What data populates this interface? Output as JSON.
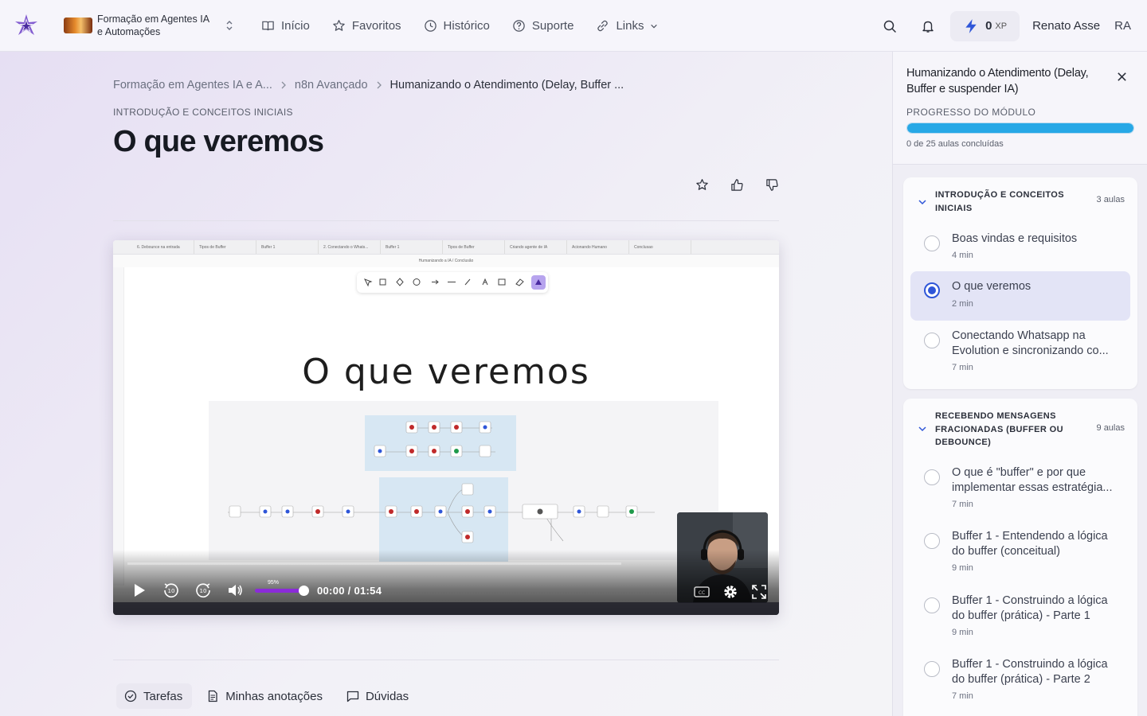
{
  "header": {
    "course_name": "Formação em Agentes IA e Automações",
    "nav": [
      {
        "label": "Início",
        "icon": "book-icon"
      },
      {
        "label": "Favoritos",
        "icon": "star-icon"
      },
      {
        "label": "Histórico",
        "icon": "clock-icon"
      },
      {
        "label": "Suporte",
        "icon": "help-circle-icon"
      },
      {
        "label": "Links",
        "icon": "link-icon"
      }
    ],
    "xp_value": "0",
    "xp_unit": "XP",
    "user_name": "Renato Asse",
    "user_initials": "RA"
  },
  "breadcrumb": {
    "items": [
      "Formação em Agentes IA e A...",
      "n8n Avançado"
    ],
    "current": "Humanizando o Atendimento (Delay, Buffer ..."
  },
  "lesson": {
    "section": "INTRODUÇÃO E CONCEITOS INICIAIS",
    "title": "O que veremos"
  },
  "video": {
    "heading": "O que veremos",
    "address": "Humanizando a IA / Conclusão",
    "tabs": [
      "6. Debounce na entrada",
      "Tipos de Buffer",
      "Buffer 1",
      "2. Conectando o Whats...",
      "Buffer 1",
      "Tipos de Buffer",
      "Criando agente de IA",
      "Acionando Humano",
      "Conclusao"
    ],
    "time": "00:00 / 01:54",
    "volume_label": "95%",
    "volume_percent": 95,
    "played_fraction": 0
  },
  "lesson_tabs": [
    {
      "label": "Tarefas",
      "active": true
    },
    {
      "label": "Minhas anotações",
      "active": false
    },
    {
      "label": "Dúvidas",
      "active": false
    }
  ],
  "panel": {
    "title": "Humanizando o Atendimento (Delay, Buffer e suspender IA)",
    "progress_label": "PROGRESSO DO MÓDULO",
    "progress_fraction": 1.0,
    "progress_count": "0 de 25 aulas concluídas",
    "modules": [
      {
        "title": "INTRODUÇÃO E CONCEITOS INICIAIS",
        "count": "3 aulas",
        "lessons": [
          {
            "name": "Boas vindas e requisitos",
            "duration": "4 min"
          },
          {
            "name": "O que veremos",
            "duration": "2 min"
          },
          {
            "name": "Conectando Whatsapp na Evolution e sincronizando co...",
            "duration": "7 min"
          }
        ]
      },
      {
        "title": "RECEBENDO MENSAGENS FRACIONADAS (BUFFER OU DEBOUNCE)",
        "count": "9 aulas",
        "lessons": [
          {
            "name": "O que é \"buffer\" e por que implementar essas estratégia...",
            "duration": "7 min"
          },
          {
            "name": "Buffer 1 - Entendendo a lógica do buffer (conceitual)",
            "duration": "9 min"
          },
          {
            "name": "Buffer 1 - Construindo a lógica do buffer (prática) - Parte 1",
            "duration": "9 min"
          },
          {
            "name": "Buffer 1 - Construindo a lógica do buffer (prática) - Parte 2",
            "duration": "7 min"
          }
        ]
      }
    ]
  },
  "colors": {
    "accent": "#2f56d8",
    "progress": "#27a8e6",
    "volume": "#8b2bd9"
  }
}
